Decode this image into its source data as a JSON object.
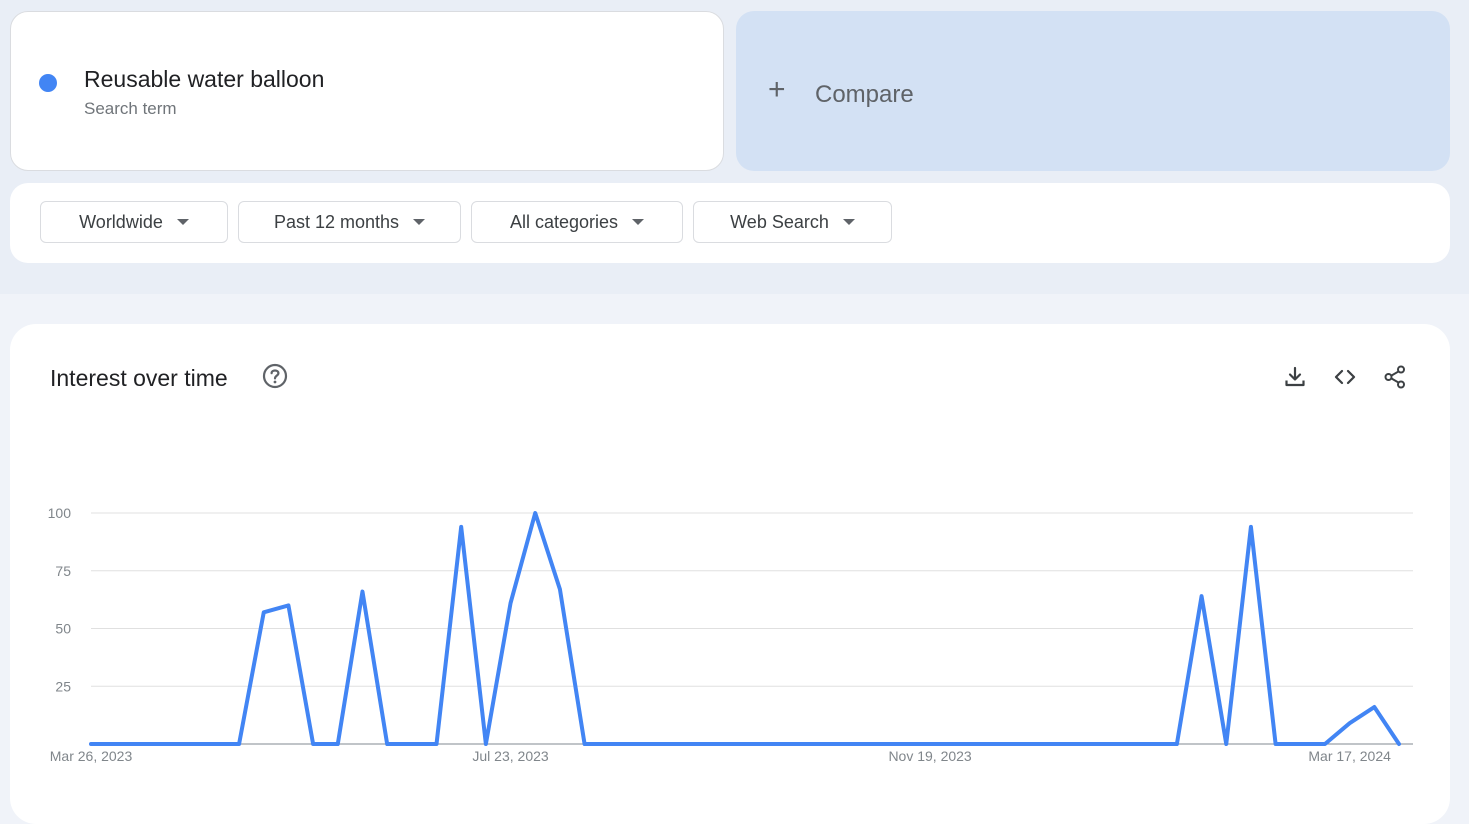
{
  "search_term": {
    "name": "Reusable water balloon",
    "type_label": "Search term",
    "color": "#4285f4"
  },
  "compare": {
    "plus": "+",
    "label": "Compare"
  },
  "filters": [
    {
      "label": "Worldwide"
    },
    {
      "label": "Past 12 months"
    },
    {
      "label": "All categories"
    },
    {
      "label": "Web Search"
    }
  ],
  "chart_section": {
    "title": "Interest over time",
    "icons": [
      "help-icon",
      "download-icon",
      "embed-icon",
      "share-icon"
    ]
  },
  "chart_data": {
    "type": "line",
    "title": "",
    "xlabel": "",
    "ylabel": "",
    "ylim": [
      0,
      100
    ],
    "yticks": [
      25,
      50,
      75,
      100
    ],
    "x_tick_labels": [
      "Mar 26, 2023",
      "Jul 23, 2023",
      "Nov 19, 2023",
      "Mar 17, 2024"
    ],
    "x_tick_indices": [
      0,
      17,
      34,
      51
    ],
    "grid": true,
    "line_color": "#4285f4",
    "series": [
      {
        "values": [
          0,
          0,
          0,
          0,
          0,
          0,
          0,
          57,
          60,
          0,
          0,
          66,
          0,
          0,
          0,
          94,
          0,
          61,
          100,
          67,
          0,
          0,
          0,
          0,
          0,
          0,
          0,
          0,
          0,
          0,
          0,
          0,
          0,
          0,
          0,
          0,
          0,
          0,
          0,
          0,
          0,
          0,
          0,
          0,
          0,
          64,
          0,
          94,
          0,
          0,
          0,
          9,
          16,
          0
        ]
      }
    ]
  }
}
